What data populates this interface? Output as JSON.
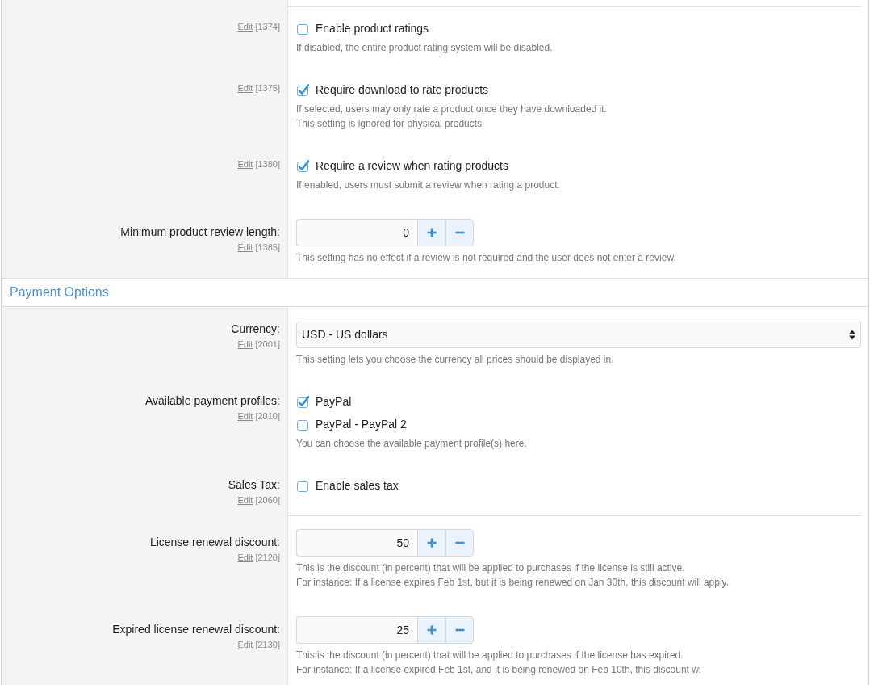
{
  "sections": [
    {
      "rows": [
        {
          "kind": "checkbox",
          "separator_above": true,
          "edit_link": "Edit",
          "setting_id": "[1374]",
          "options": [
            {
              "label": "Enable product ratings",
              "checked": false
            }
          ],
          "hints": [
            "If disabled, the entire product rating system will be disabled."
          ]
        },
        {
          "kind": "checkbox",
          "separator_above": false,
          "edit_link": "Edit",
          "setting_id": "[1375]",
          "options": [
            {
              "label": "Require download to rate products",
              "checked": true
            }
          ],
          "hints": [
            "If selected, users may only rate a product once they have downloaded it.",
            "This setting is ignored for physical products."
          ]
        },
        {
          "kind": "checkbox",
          "separator_above": false,
          "edit_link": "Edit",
          "setting_id": "[1380]",
          "options": [
            {
              "label": "Require a review when rating products",
              "checked": true
            }
          ],
          "hints": [
            "If enabled, users must submit a review when rating a product."
          ]
        },
        {
          "kind": "spinner",
          "separator_above": false,
          "label": "Minimum product review length:",
          "edit_link": "Edit",
          "setting_id": "[1385]",
          "value": "0",
          "hints": [
            "This setting has no effect if a review is not required and the user does not enter a review."
          ]
        }
      ]
    },
    {
      "title": "Payment Options",
      "rows": [
        {
          "kind": "select",
          "separator_above": false,
          "label": "Currency:",
          "edit_link": "Edit",
          "setting_id": "[2001]",
          "value": "USD - US dollars",
          "hints": [
            "This setting lets you choose the currency all prices should be displayed in."
          ]
        },
        {
          "kind": "checkbox",
          "separator_above": false,
          "label": "Available payment profiles:",
          "edit_link": "Edit",
          "setting_id": "[2010]",
          "options": [
            {
              "label": "PayPal",
              "checked": true
            },
            {
              "label": "PayPal - PayPal 2",
              "checked": false
            }
          ],
          "hints": [
            "You can choose the available payment profile(s) here."
          ]
        },
        {
          "kind": "checkbox",
          "separator_above": false,
          "label": "Sales Tax:",
          "edit_link": "Edit",
          "setting_id": "[2060]",
          "options": [
            {
              "label": "Enable sales tax",
              "checked": false
            }
          ]
        },
        {
          "kind": "spinner",
          "separator_above": true,
          "label": "License renewal discount:",
          "edit_link": "Edit",
          "setting_id": "[2120]",
          "value": "50",
          "hints": [
            "This is the discount (in percent) that will be applied to purchases if the license is still active.",
            "For instance: If a license expires Feb 1st, but it is being renewed on Jan 30th, this discount will apply."
          ]
        },
        {
          "kind": "spinner",
          "separator_above": false,
          "label": "Expired license renewal discount:",
          "edit_link": "Edit",
          "setting_id": "[2130]",
          "value": "25",
          "hints": [
            "This is the discount (in percent) that will be applied to purchases if the license has expired.",
            "For instance: If a license expired Feb 1st, and it is being renewed on Feb 10th, this discount wi"
          ]
        }
      ]
    }
  ]
}
